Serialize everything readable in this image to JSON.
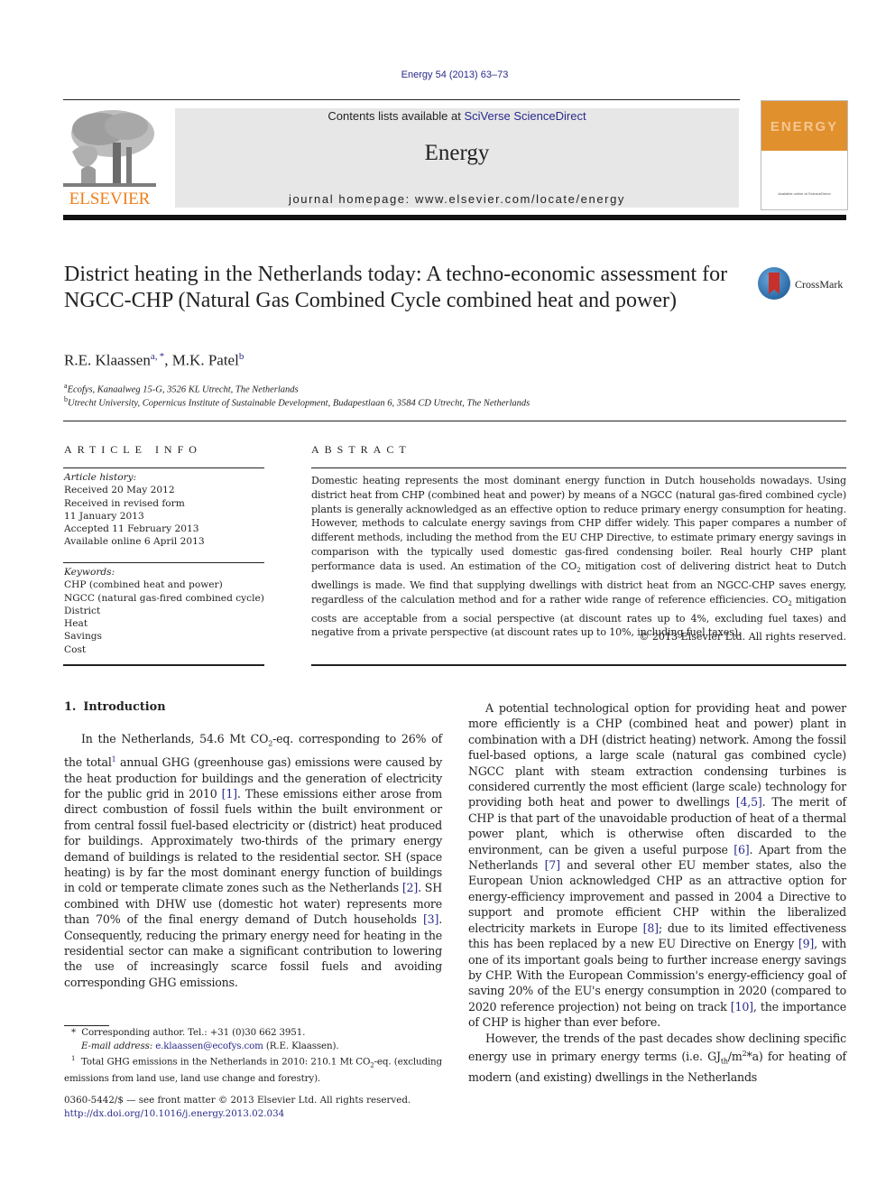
{
  "header": {
    "citation": "Energy 54 (2013) 63–73",
    "contents_prefix": "Contents lists available at ",
    "contents_link": "SciVerse ScienceDirect",
    "journal_name": "Energy",
    "homepage": "journal homepage: www.elsevier.com/locate/energy",
    "publisher_logo_text": "ELSEVIER",
    "cover_title": "ENERGY",
    "cover_footer": "Available online at ScienceDirect",
    "crossmark_label": "CrossMark",
    "colors": {
      "elsevier_orange": "#f07e1a",
      "cover_orange": "#e0902d",
      "link_blue": "#2a2a8c",
      "band_gray": "#e7e7e7"
    }
  },
  "article": {
    "title": "District heating in the Netherlands today: A techno-economic assessment for NGCC-CHP (Natural Gas Combined Cycle combined heat and power)",
    "authors": [
      {
        "name": "R.E. Klaassen",
        "marks": "a, *"
      },
      {
        "name": "M.K. Patel",
        "marks": "b"
      }
    ],
    "affiliations": [
      {
        "mark": "a",
        "text": "Ecofys, Kanaalweg 15-G, 3526 KL Utrecht, The Netherlands"
      },
      {
        "mark": "b",
        "text": "Utrecht University, Copernicus Institute of Sustainable Development, Budapestlaan 6, 3584 CD Utrecht, The Netherlands"
      }
    ]
  },
  "article_info": {
    "heading": "ARTICLE INFO",
    "history_label": "Article history:",
    "history": [
      "Received 20 May 2012",
      "Received in revised form",
      "11 January 2013",
      "Accepted 11 February 2013",
      "Available online 6 April 2013"
    ],
    "keywords_label": "Keywords:",
    "keywords": [
      "CHP (combined heat and power)",
      "NGCC (natural gas-fired combined cycle)",
      "District",
      "Heat",
      "Savings",
      "Cost"
    ]
  },
  "abstract": {
    "heading": "ABSTRACT",
    "text_1": "Domestic heating represents the most dominant energy function in Dutch households nowadays. Using district heat from CHP (combined heat and power) by means of a NGCC (natural gas-fired combined cycle) plants is generally acknowledged as an effective option to reduce primary energy consumption for heating. However, methods to calculate energy savings from CHP differ widely. This paper compares a number of different methods, including the method from the EU CHP Directive, to estimate primary energy savings in comparison with the typically used domestic gas-fired condensing boiler. Real hourly CHP plant performance data is used. An estimation of the CO",
    "text_2": " mitigation cost of delivering district heat to Dutch dwellings is made. We find that supplying dwellings with district heat from an NGCC-CHP saves energy, regardless of the calculation method and for a rather wide range of reference efficiencies. CO",
    "text_3": " mitigation costs are acceptable from a social perspective (at discount rates up to 4%, excluding fuel taxes) and negative from a private perspective (at discount rates up to 10%, including fuel taxes).",
    "sub_2": "2",
    "copyright": "© 2013 Elsevier Ltd. All rights reserved."
  },
  "section1": {
    "number": "1.",
    "title": "Introduction",
    "left_p1_a": "In the Netherlands, 54.6 Mt CO",
    "left_p1_sub": "2",
    "left_p1_b": "-eq. corresponding to 26% of the total",
    "left_p1_fn": "1",
    "left_p1_c": " annual GHG (greenhouse gas) emissions were caused by the heat production for buildings and the generation of electricity for the public grid in 2010 ",
    "ref1": "[1]",
    "left_p1_d": ". These emissions either arose from direct combustion of fossil fuels within the built environment or from central fossil fuel-based electricity or (district) heat produced for buildings. Approximately two-thirds of the primary energy demand of buildings is related to the residential sector. SH (space heating) is by far the most dominant energy function of buildings in cold or temperate climate zones such as the Netherlands ",
    "ref2": "[2]",
    "left_p1_e": ". SH combined with DHW use (domestic hot water) represents more than 70% of the final energy demand of Dutch households ",
    "ref3": "[3]",
    "left_p1_f": ". Consequently, reducing the primary energy need for heating in the residential sector can make a significant contribution to lowering the use of increasingly scarce fossil fuels and avoiding corresponding GHG emissions.",
    "right_p1_a": "A potential technological option for providing heat and power more efficiently is a CHP (combined heat and power) plant in combination with a DH (district heating) network. Among the fossil fuel-based options, a large scale (natural gas combined cycle) NGCC plant with steam extraction condensing turbines is considered currently the most efficient (large scale) technology for providing both heat and power to dwellings ",
    "ref45": "[4,5]",
    "right_p1_b": ". The merit of CHP is that part of the unavoidable production of heat of a thermal power plant, which is otherwise often discarded to the environment, can be given a useful purpose ",
    "ref6": "[6]",
    "right_p1_c": ". Apart from the Netherlands ",
    "ref7": "[7]",
    "right_p1_d": " and several other EU member states, also the European Union acknowledged CHP as an attractive option for energy-efficiency improvement and passed in 2004 a Directive to support and promote efficient CHP within the liberalized electricity markets in Europe ",
    "ref8": "[8]",
    "right_p1_e": "; due to its limited effectiveness this has been replaced by a new EU Directive on Energy ",
    "ref9": "[9]",
    "right_p1_f": ", with one of its important goals being to further increase energy savings by CHP. With the European Commission's energy-efficiency goal of saving 20% of the EU's energy consumption in 2020 (compared to 2020 reference projection) not being on track ",
    "ref10": "[10]",
    "right_p1_g": ", the importance of CHP is higher than ever before.",
    "right_p2_a": "However, the trends of the past decades show declining specific energy use in primary energy terms (i.e. GJ",
    "right_p2_sub": "th",
    "right_p2_b": "/m",
    "right_p2_sup": "2",
    "right_p2_c": "*a) for heating of modern (and existing) dwellings in the Netherlands"
  },
  "footnotes": {
    "corresponding_mark": "*",
    "corresponding": "Corresponding author. Tel.: +31 (0)30 662 3951.",
    "email_label": "E-mail address:",
    "email": "e.klaassen@ecofys.com",
    "email_suffix": " (R.E. Klaassen).",
    "fn1_mark": "1",
    "fn1_a": "Total GHG emissions in the Netherlands in 2010: 210.1 Mt CO",
    "fn1_sub": "2",
    "fn1_b": "-eq. (excluding emissions from land use, land use change and forestry)."
  },
  "issn": {
    "line": "0360-5442/$ — see front matter © 2013 Elsevier Ltd. All rights reserved.",
    "doi": "http://dx.doi.org/10.1016/j.energy.2013.02.034"
  }
}
